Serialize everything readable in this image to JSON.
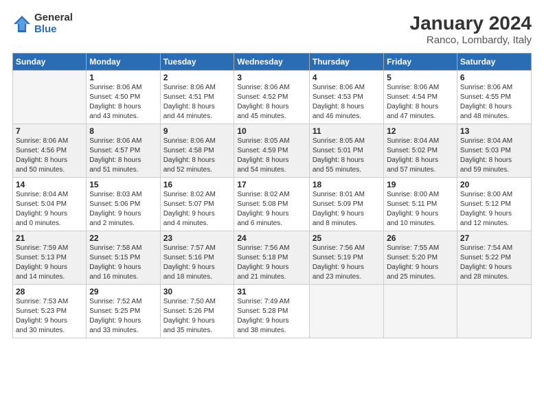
{
  "header": {
    "logo_general": "General",
    "logo_blue": "Blue",
    "title": "January 2024",
    "subtitle": "Ranco, Lombardy, Italy"
  },
  "days_of_week": [
    "Sunday",
    "Monday",
    "Tuesday",
    "Wednesday",
    "Thursday",
    "Friday",
    "Saturday"
  ],
  "weeks": [
    [
      {
        "day": "",
        "info": ""
      },
      {
        "day": "1",
        "info": "Sunrise: 8:06 AM\nSunset: 4:50 PM\nDaylight: 8 hours\nand 43 minutes."
      },
      {
        "day": "2",
        "info": "Sunrise: 8:06 AM\nSunset: 4:51 PM\nDaylight: 8 hours\nand 44 minutes."
      },
      {
        "day": "3",
        "info": "Sunrise: 8:06 AM\nSunset: 4:52 PM\nDaylight: 8 hours\nand 45 minutes."
      },
      {
        "day": "4",
        "info": "Sunrise: 8:06 AM\nSunset: 4:53 PM\nDaylight: 8 hours\nand 46 minutes."
      },
      {
        "day": "5",
        "info": "Sunrise: 8:06 AM\nSunset: 4:54 PM\nDaylight: 8 hours\nand 47 minutes."
      },
      {
        "day": "6",
        "info": "Sunrise: 8:06 AM\nSunset: 4:55 PM\nDaylight: 8 hours\nand 48 minutes."
      }
    ],
    [
      {
        "day": "7",
        "info": "Sunrise: 8:06 AM\nSunset: 4:56 PM\nDaylight: 8 hours\nand 50 minutes."
      },
      {
        "day": "8",
        "info": "Sunrise: 8:06 AM\nSunset: 4:57 PM\nDaylight: 8 hours\nand 51 minutes."
      },
      {
        "day": "9",
        "info": "Sunrise: 8:06 AM\nSunset: 4:58 PM\nDaylight: 8 hours\nand 52 minutes."
      },
      {
        "day": "10",
        "info": "Sunrise: 8:05 AM\nSunset: 4:59 PM\nDaylight: 8 hours\nand 54 minutes."
      },
      {
        "day": "11",
        "info": "Sunrise: 8:05 AM\nSunset: 5:01 PM\nDaylight: 8 hours\nand 55 minutes."
      },
      {
        "day": "12",
        "info": "Sunrise: 8:04 AM\nSunset: 5:02 PM\nDaylight: 8 hours\nand 57 minutes."
      },
      {
        "day": "13",
        "info": "Sunrise: 8:04 AM\nSunset: 5:03 PM\nDaylight: 8 hours\nand 59 minutes."
      }
    ],
    [
      {
        "day": "14",
        "info": "Sunrise: 8:04 AM\nSunset: 5:04 PM\nDaylight: 9 hours\nand 0 minutes."
      },
      {
        "day": "15",
        "info": "Sunrise: 8:03 AM\nSunset: 5:06 PM\nDaylight: 9 hours\nand 2 minutes."
      },
      {
        "day": "16",
        "info": "Sunrise: 8:02 AM\nSunset: 5:07 PM\nDaylight: 9 hours\nand 4 minutes."
      },
      {
        "day": "17",
        "info": "Sunrise: 8:02 AM\nSunset: 5:08 PM\nDaylight: 9 hours\nand 6 minutes."
      },
      {
        "day": "18",
        "info": "Sunrise: 8:01 AM\nSunset: 5:09 PM\nDaylight: 9 hours\nand 8 minutes."
      },
      {
        "day": "19",
        "info": "Sunrise: 8:00 AM\nSunset: 5:11 PM\nDaylight: 9 hours\nand 10 minutes."
      },
      {
        "day": "20",
        "info": "Sunrise: 8:00 AM\nSunset: 5:12 PM\nDaylight: 9 hours\nand 12 minutes."
      }
    ],
    [
      {
        "day": "21",
        "info": "Sunrise: 7:59 AM\nSunset: 5:13 PM\nDaylight: 9 hours\nand 14 minutes."
      },
      {
        "day": "22",
        "info": "Sunrise: 7:58 AM\nSunset: 5:15 PM\nDaylight: 9 hours\nand 16 minutes."
      },
      {
        "day": "23",
        "info": "Sunrise: 7:57 AM\nSunset: 5:16 PM\nDaylight: 9 hours\nand 18 minutes."
      },
      {
        "day": "24",
        "info": "Sunrise: 7:56 AM\nSunset: 5:18 PM\nDaylight: 9 hours\nand 21 minutes."
      },
      {
        "day": "25",
        "info": "Sunrise: 7:56 AM\nSunset: 5:19 PM\nDaylight: 9 hours\nand 23 minutes."
      },
      {
        "day": "26",
        "info": "Sunrise: 7:55 AM\nSunset: 5:20 PM\nDaylight: 9 hours\nand 25 minutes."
      },
      {
        "day": "27",
        "info": "Sunrise: 7:54 AM\nSunset: 5:22 PM\nDaylight: 9 hours\nand 28 minutes."
      }
    ],
    [
      {
        "day": "28",
        "info": "Sunrise: 7:53 AM\nSunset: 5:23 PM\nDaylight: 9 hours\nand 30 minutes."
      },
      {
        "day": "29",
        "info": "Sunrise: 7:52 AM\nSunset: 5:25 PM\nDaylight: 9 hours\nand 33 minutes."
      },
      {
        "day": "30",
        "info": "Sunrise: 7:50 AM\nSunset: 5:26 PM\nDaylight: 9 hours\nand 35 minutes."
      },
      {
        "day": "31",
        "info": "Sunrise: 7:49 AM\nSunset: 5:28 PM\nDaylight: 9 hours\nand 38 minutes."
      },
      {
        "day": "",
        "info": ""
      },
      {
        "day": "",
        "info": ""
      },
      {
        "day": "",
        "info": ""
      }
    ]
  ]
}
